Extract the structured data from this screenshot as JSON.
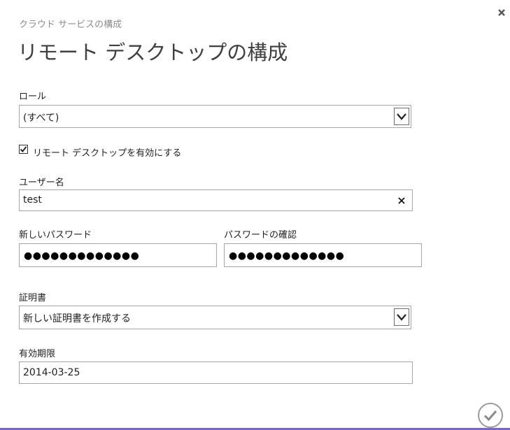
{
  "header": {
    "subtitle": "クラウド サービスの構成",
    "title": "リモート デスクトップの構成",
    "close_icon": "close-icon"
  },
  "form": {
    "role": {
      "label": "ロール",
      "selected": "(すべて)"
    },
    "enable_rdp": {
      "label": "リモート デスクトップを有効にする",
      "checked": true
    },
    "username": {
      "label": "ユーザー名",
      "value": "test"
    },
    "new_password": {
      "label": "新しいパスワード",
      "masked_value": "●●●●●●●●●●●●●"
    },
    "confirm_password": {
      "label": "パスワードの確認",
      "masked_value": "●●●●●●●●●●●●●"
    },
    "certificate": {
      "label": "証明書",
      "selected": "新しい証明書を作成する"
    },
    "expiration": {
      "label": "有効期限",
      "value": "2014-03-25"
    }
  },
  "footer": {
    "confirm_icon": "checkmark-circle-icon",
    "accent_color": "#7b66c9"
  }
}
